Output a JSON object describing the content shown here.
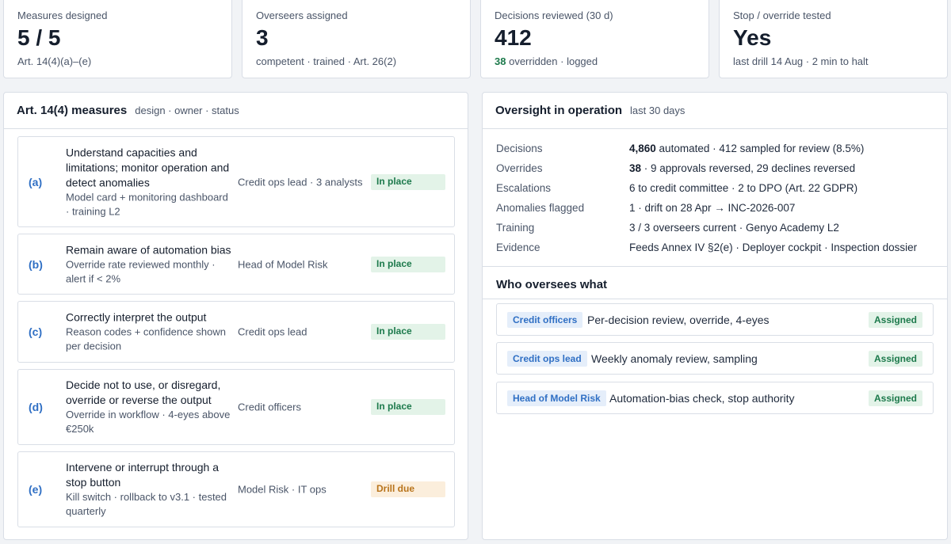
{
  "kpis": [
    {
      "label": "Measures designed",
      "value": "5 / 5",
      "sub": "Art. 14(4)(a)–(e)"
    },
    {
      "label": "Overseers assigned",
      "value": "3",
      "sub": "competent · trained · Art. 26(2)"
    },
    {
      "label": "Decisions reviewed (30 d)",
      "value": "412",
      "sub_highlight": "38",
      "sub_rest": "overridden · logged"
    },
    {
      "label": "Stop / override tested",
      "value": "Yes",
      "sub": "last drill 14 Aug · 2 min to halt"
    }
  ],
  "measures_panel": {
    "title": "Art. 14(4) measures",
    "subtitle": "design · owner · status",
    "items": [
      {
        "letter": "(a)",
        "title": "Understand capacities and limitations; monitor operation and detect anomalies",
        "desc": "Model card + monitoring dashboard · training L2",
        "owner": "Credit ops lead · 3 analysts",
        "status": "In place"
      },
      {
        "letter": "(b)",
        "title": "Remain aware of automation bias",
        "desc": "Override rate reviewed monthly · alert if < 2%",
        "owner": "Head of Model Risk",
        "status": "In place"
      },
      {
        "letter": "(c)",
        "title": "Correctly interpret the output",
        "desc": "Reason codes + confidence shown per decision",
        "owner": "Credit ops lead",
        "status": "In place"
      },
      {
        "letter": "(d)",
        "title": "Decide not to use, or disregard, override or reverse the output",
        "desc": "Override in workflow · 4-eyes above €250k",
        "owner": "Credit officers",
        "status": "In place"
      },
      {
        "letter": "(e)",
        "title": "Intervene or interrupt through a stop button",
        "desc": "Kill switch · rollback to v3.1 · tested quarterly",
        "owner": "Model Risk · IT ops",
        "status": "Drill due"
      }
    ]
  },
  "ops_panel": {
    "title": "Oversight in operation",
    "subtitle": "last 30 days",
    "rows": [
      {
        "key": "Decisions",
        "bold": "4,860",
        "rest": " automated · 412 sampled for review (8.5%)"
      },
      {
        "key": "Overrides",
        "bold": "38",
        "rest": " · 9 approvals reversed, 29 declines reversed"
      },
      {
        "key": "Escalations",
        "bold": "",
        "rest": "6 to credit committee · 2 to DPO (Art. 22 GDPR)"
      },
      {
        "key": "Anomalies flagged",
        "bold": "",
        "rest": "1 · drift on 28 Apr → INC-2026-007"
      },
      {
        "key": "Training",
        "bold": "",
        "rest": "3 / 3 overseers current · Genyo Academy L2"
      },
      {
        "key": "Evidence",
        "bold": "",
        "rest": "Feeds Annex IV §2(e) · Deployer cockpit · Inspection dossier"
      }
    ],
    "who_title": "Who oversees what",
    "who": [
      {
        "role": "Credit officers",
        "text": "Per-decision review, override, 4-eyes",
        "status": "Assigned"
      },
      {
        "role": "Credit ops lead",
        "text": "Weekly anomaly review, sampling",
        "status": "Assigned"
      },
      {
        "role": "Head of Model Risk",
        "text": "Automation-bias check, stop authority",
        "status": "Assigned"
      }
    ]
  },
  "colors": {
    "accent": "#2f6fc4",
    "success": "#1d7a4c",
    "warning": "#b8741c"
  }
}
